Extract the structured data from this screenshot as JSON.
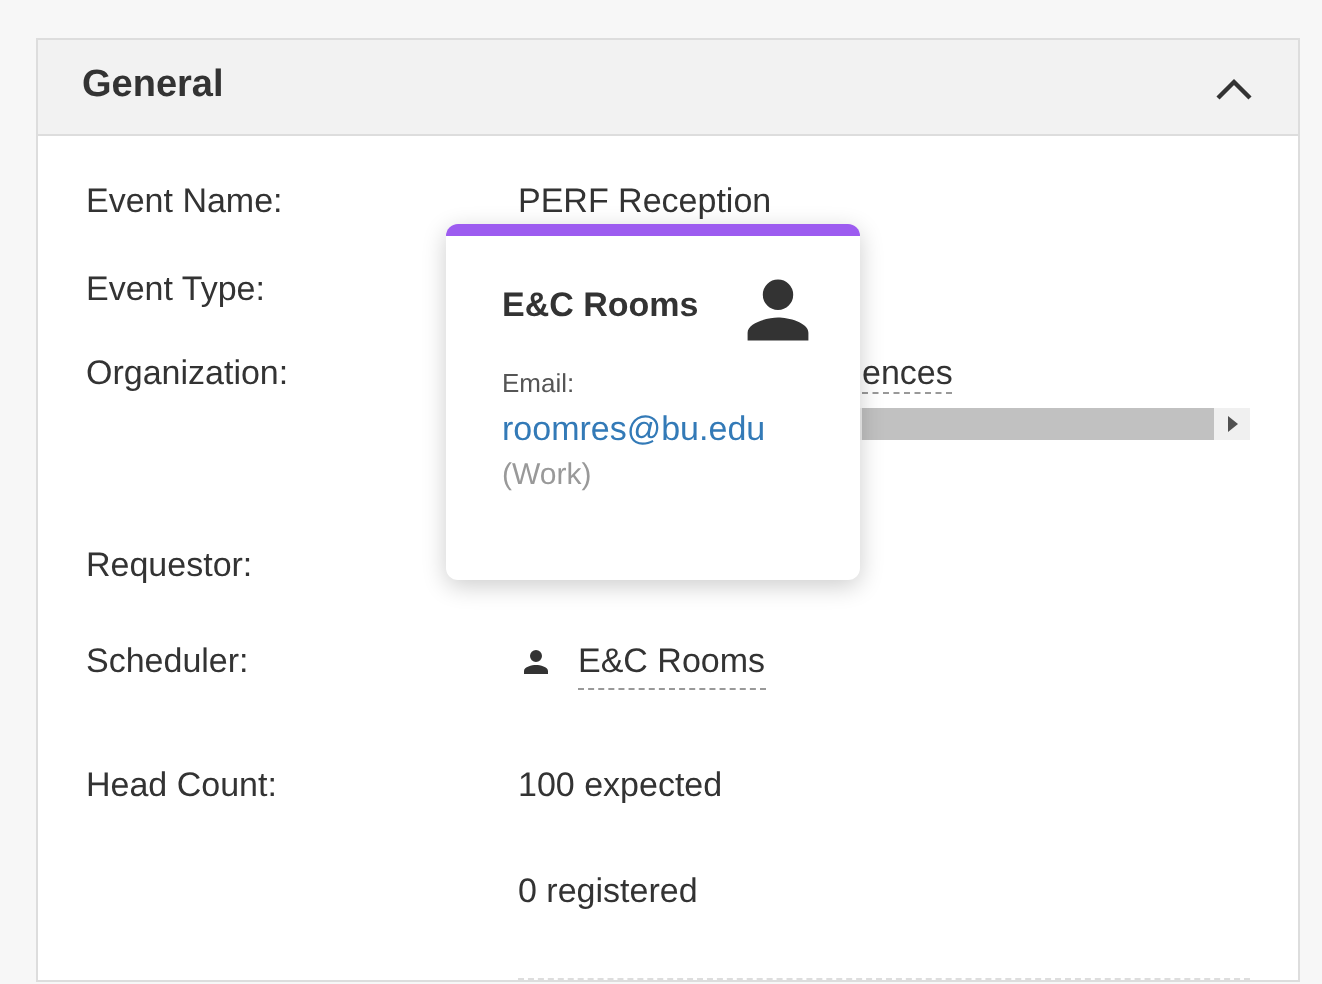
{
  "panel": {
    "title": "General",
    "expanded": true
  },
  "fields": [
    {
      "kind": "text",
      "label": "Event Name:",
      "value": "PERF Reception"
    },
    {
      "kind": "text",
      "label": "Event Type:"
    },
    {
      "kind": "link",
      "label": "Organization:",
      "value": "ences",
      "scrollbar": true
    },
    {
      "kind": "text",
      "label": "Requestor:"
    },
    {
      "kind": "person",
      "label": "Scheduler:",
      "value": "E&C Rooms"
    },
    {
      "kind": "lines",
      "label": "Head Count:",
      "lines": [
        "100 expected",
        "0 registered"
      ]
    }
  ],
  "popover": {
    "name": "E&C Rooms",
    "email_label": "Email:",
    "email": "roomres@bu.edu",
    "email_type": "(Work)"
  }
}
